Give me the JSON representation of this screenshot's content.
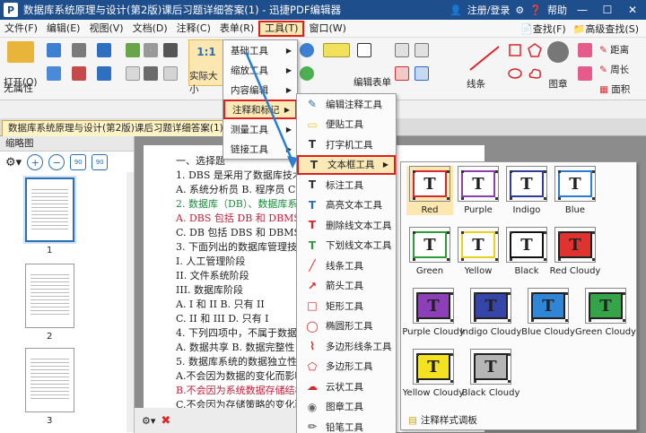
{
  "titlebar": {
    "logo": "P",
    "title": "数据库系统原理与设计(第2版)课后习题详细答案(1) - 迅捷PDF编辑器",
    "login": "注册/登录",
    "help": "帮助"
  },
  "menubar": {
    "items": [
      "文件(F)",
      "编辑(E)",
      "视图(V)",
      "文档(D)",
      "注释(C)",
      "表单(R)",
      "工具(T)",
      "窗口(W)"
    ],
    "find": "查找(F)",
    "advanced_find": "高级查找(S)"
  },
  "toolbar": {
    "open": "打开(O)",
    "actual_size": "实际大小",
    "edit_form": "编辑表单",
    "lines": "线条",
    "stamp": "图章",
    "distance": "距离",
    "perimeter": "周长",
    "area": "面积"
  },
  "properties_label": "无属性",
  "doc_tab": "数据库系统原理与设计(第2版)课后习题详细答案(1) *",
  "thumbnails": {
    "title": "缩略图",
    "pages": [
      "1",
      "2",
      "3"
    ],
    "zoom_values": [
      "90",
      "90"
    ]
  },
  "document": {
    "lines": [
      {
        "text": "一、选择题",
        "cls": ""
      },
      {
        "text": "1. DBS 是采用了数据库技术的",
        "cls": ""
      },
      {
        "text": "A. 系统分析员 B. 程序员 C.",
        "cls": ""
      },
      {
        "text": "2. 数据库（DB）、数据库系统",
        "cls": "green"
      },
      {
        "text": "A. DBS 包括 DB 和 DBMS B. D",
        "cls": "red"
      },
      {
        "text": "C. DB 包括 DBS 和 DBMS D. D",
        "cls": ""
      },
      {
        "text": "3. 下面列出的数据库管理技术",
        "cls": ""
      },
      {
        "text": "I. 人工管理阶段",
        "cls": ""
      },
      {
        "text": "II. 文件系统阶段",
        "cls": ""
      },
      {
        "text": "III. 数据库阶段",
        "cls": ""
      },
      {
        "text": "A. I 和 II B. 只有 II",
        "cls": ""
      },
      {
        "text": "C. II 和 III D. 只有 I",
        "cls": "mixed"
      },
      {
        "text": "4. 下列四项中，不属于数据库",
        "cls": ""
      },
      {
        "text": "A. 数据共享 B. 数据完整性 C",
        "cls": ""
      },
      {
        "text": "5. 数据库系统的数据独立性体",
        "cls": ""
      },
      {
        "text": "A.不会因为数据的变化而影响",
        "cls": ""
      },
      {
        "text": "B.不会因为系统数据存储结构",
        "cls": "red"
      },
      {
        "text": "C.不会因为存储策略的变化而",
        "cls": ""
      }
    ]
  },
  "menu_tools": {
    "items": [
      "基础工具",
      "缩放工具",
      "内容编辑",
      "注释和标记",
      "测量工具",
      "链接工具"
    ],
    "highlighted": "注释和标记"
  },
  "menu_annotation": {
    "items": [
      "编辑注释工具",
      "便贴工具",
      "打字机工具",
      "文本框工具",
      "标注工具",
      "高亮文本工具",
      "删除线文本工具",
      "下划线文本工具",
      "线条工具",
      "箭头工具",
      "矩形工具",
      "椭圆形工具",
      "多边形线条工具",
      "多边形工具",
      "云状工具",
      "图章工具",
      "铅笔工具"
    ],
    "highlighted": "文本框工具"
  },
  "palette": {
    "glyph": "T",
    "styles": [
      {
        "label": "Red",
        "border": "#d9262b",
        "fill": "#ffffff",
        "selected": true
      },
      {
        "label": "Purple",
        "border": "#8b3fb0",
        "fill": "#ffffff",
        "selected": false
      },
      {
        "label": "Indigo",
        "border": "#2e3d9a",
        "fill": "#ffffff",
        "selected": false
      },
      {
        "label": "Blue",
        "border": "#2b7fd0",
        "fill": "#ffffff",
        "selected": false
      },
      {
        "label": "Green",
        "border": "#2f9a3a",
        "fill": "#ffffff",
        "selected": false
      },
      {
        "label": "Yellow",
        "border": "#e8d21c",
        "fill": "#ffffff",
        "selected": false
      },
      {
        "label": "Black",
        "border": "#111111",
        "fill": "#ffffff",
        "selected": false
      },
      {
        "label": "Red Cloudy",
        "border": "#222222",
        "fill": "#e0322e",
        "selected": false
      },
      {
        "label": "Purple Cloudy",
        "border": "#222222",
        "fill": "#8c3fb6",
        "selected": false
      },
      {
        "label": "Indigo Cloudy",
        "border": "#222222",
        "fill": "#3546a8",
        "selected": false
      },
      {
        "label": "Blue Cloudy",
        "border": "#222222",
        "fill": "#2f86d6",
        "selected": false
      },
      {
        "label": "Green Cloudy",
        "border": "#222222",
        "fill": "#35a347",
        "selected": false
      },
      {
        "label": "Yellow Cloudy",
        "border": "#222222",
        "fill": "#f2e222",
        "selected": false
      },
      {
        "label": "Black Cloudy",
        "border": "#222222",
        "fill": "#b5b5b5",
        "selected": false
      }
    ],
    "footer": "注释样式调板"
  }
}
